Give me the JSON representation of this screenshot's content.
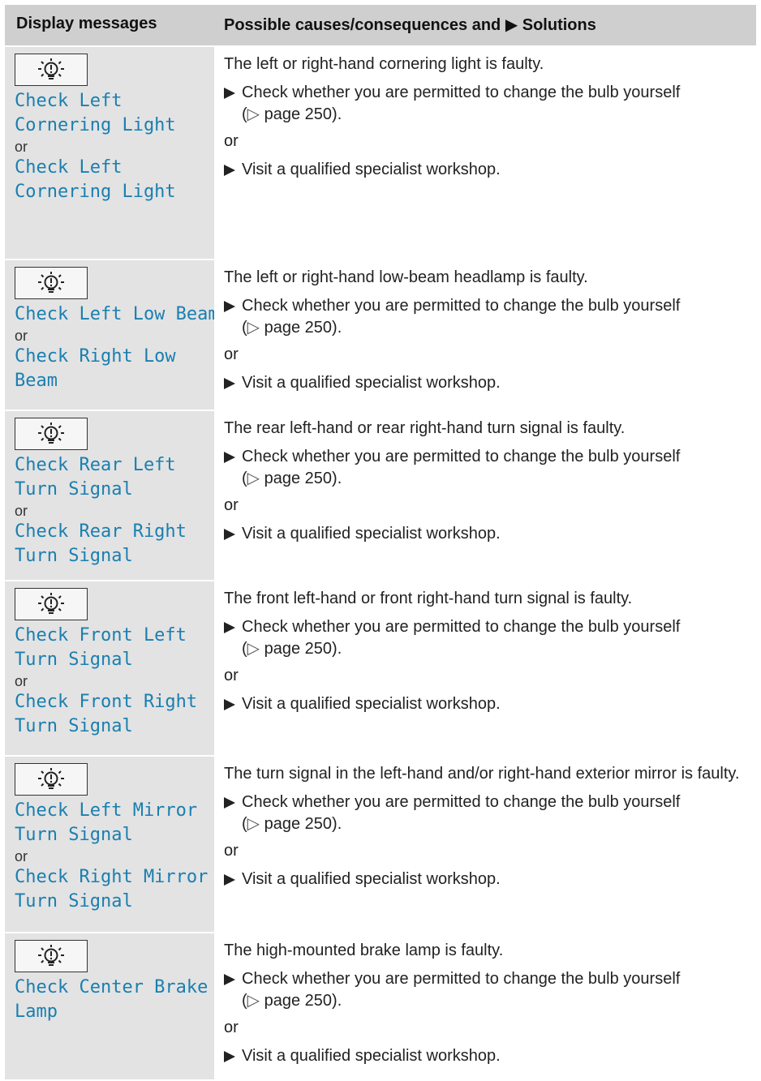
{
  "header": {
    "col1": "Display messages",
    "col2": "Possible causes/consequences and ▶ Solutions"
  },
  "common": {
    "or": "or",
    "step_check": "Check whether you are permitted to change the bulb yourself",
    "page_ref_symbol": "▷",
    "page_ref": "page 250).",
    "step_visit": "Visit a qualified specialist workshop.",
    "icon": "bulb-warning-icon"
  },
  "rows": [
    {
      "msg1": "Check Left\nCornering Light",
      "msg2": "Check Left\nCornering Light",
      "desc": "The left or right-hand cornering light is faulty."
    },
    {
      "msg1": "Check Left Low Beam",
      "msg2": "Check Right Low\nBeam",
      "desc": "The left or right-hand low-beam headlamp is faulty."
    },
    {
      "msg1": "Check Rear Left\nTurn Signal",
      "msg2": "Check Rear Right\nTurn Signal",
      "desc": "The rear left-hand or rear right-hand turn signal is faulty."
    },
    {
      "msg1": "Check Front Left\nTurn Signal",
      "msg2": "Check Front Right\nTurn Signal",
      "desc": "The front left-hand or front right-hand turn signal is faulty."
    },
    {
      "msg1": "Check Left Mirror\nTurn Signal",
      "msg2": "Check Right Mirror\nTurn Signal",
      "desc": "The turn signal in the left-hand and/or right-hand exterior mirror is faulty."
    },
    {
      "msg1": "Check Center Brake\nLamp",
      "msg2": "",
      "desc": "The high-mounted brake lamp is faulty."
    }
  ]
}
